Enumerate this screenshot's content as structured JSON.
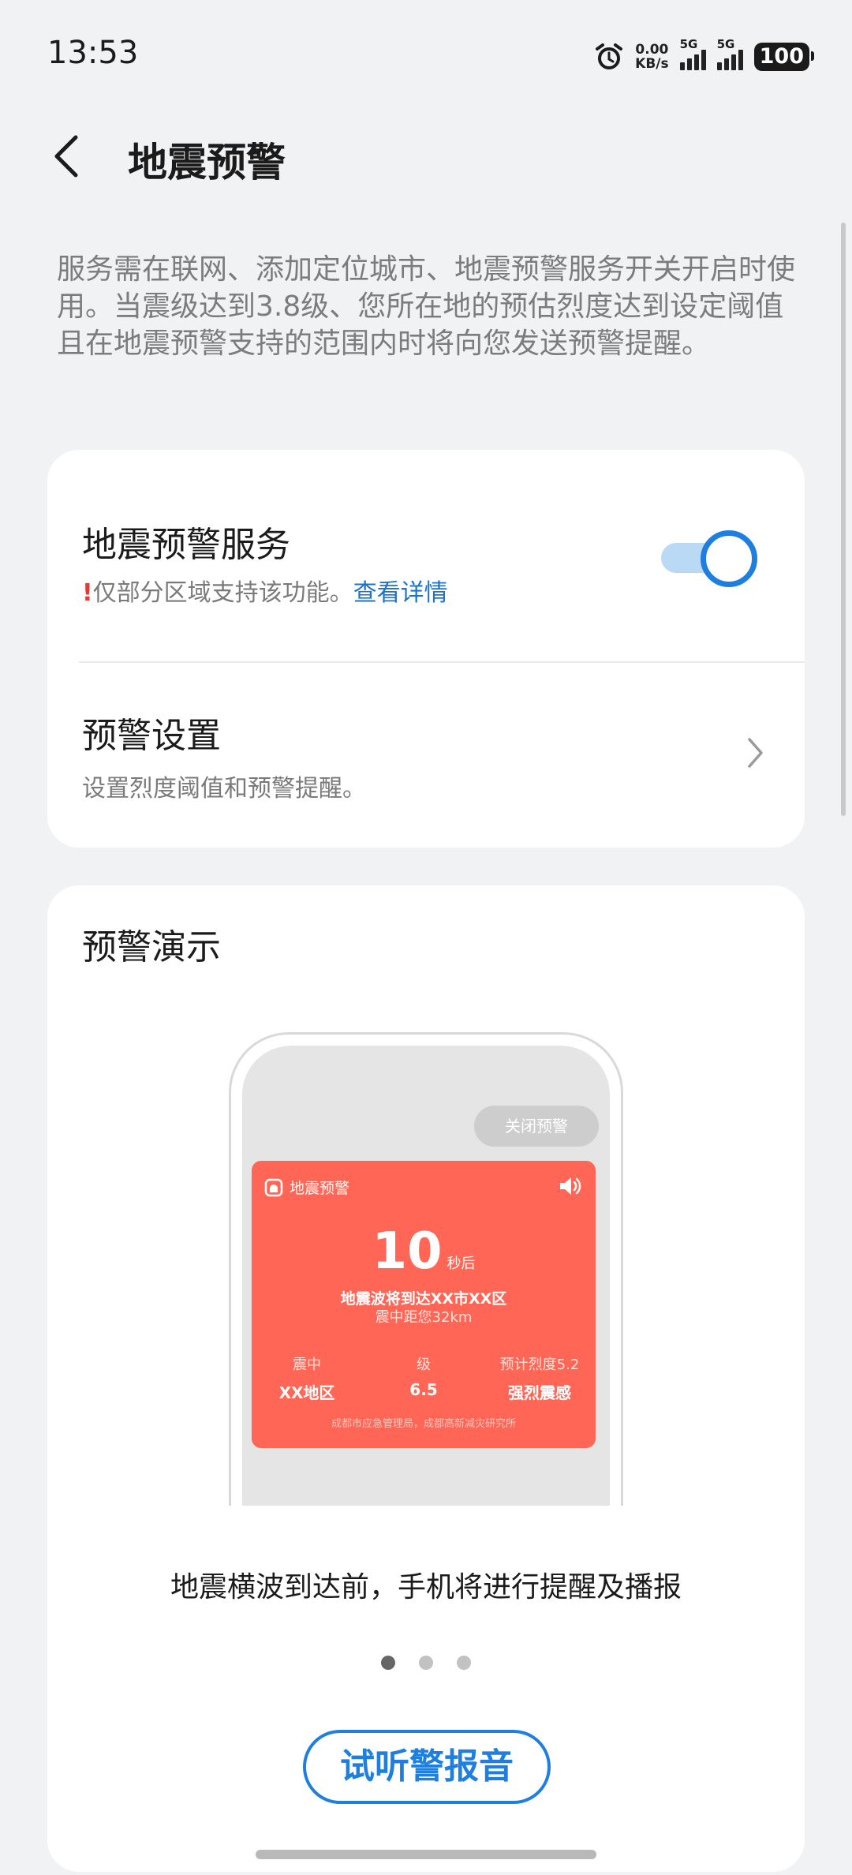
{
  "status": {
    "time": "13:53",
    "net_speed_value": "0.00",
    "net_speed_unit": "KB/s",
    "sim1": "5G",
    "sim2": "5G",
    "battery": "100"
  },
  "header": {
    "title": "地震预警"
  },
  "description": "服务需在联网、添加定位城市、地震预警服务开关开启时使用。当震级达到3.8级、您所在地的预估烈度达到设定阈值且在地震预警支持的范围内时将向您发送预警提醒。",
  "service": {
    "title": "地震预警服务",
    "warn_mark": "!",
    "note": "仅部分区域支持该功能。",
    "link": "查看详情",
    "toggle_on": true
  },
  "settings": {
    "title": "预警设置",
    "subtitle": "设置烈度阈值和预警提醒。"
  },
  "demo": {
    "title": "预警演示",
    "close_button": "关闭预警",
    "alert_title": "地震预警",
    "countdown": "10",
    "countdown_unit": "秒后",
    "arrive_text": "地震波将到达XX市XX区",
    "distance_text": "震中距您32km",
    "epicenter_label": "震中",
    "epicenter_value": "XX地区",
    "magnitude_label": "级",
    "magnitude_value": "6.5",
    "intensity_label": "预计烈度5.2",
    "intensity_value": "强烈震感",
    "source": "成都市应急管理局，成都高新减灾研究所",
    "caption": "地震横波到达前，手机将进行提醒及播报",
    "page_count": 3,
    "active_page": 1,
    "listen_button": "试听警报音"
  },
  "colors": {
    "accent": "#1f7fe0",
    "alert_red": "#ff6656",
    "background": "#f1f2f4"
  }
}
